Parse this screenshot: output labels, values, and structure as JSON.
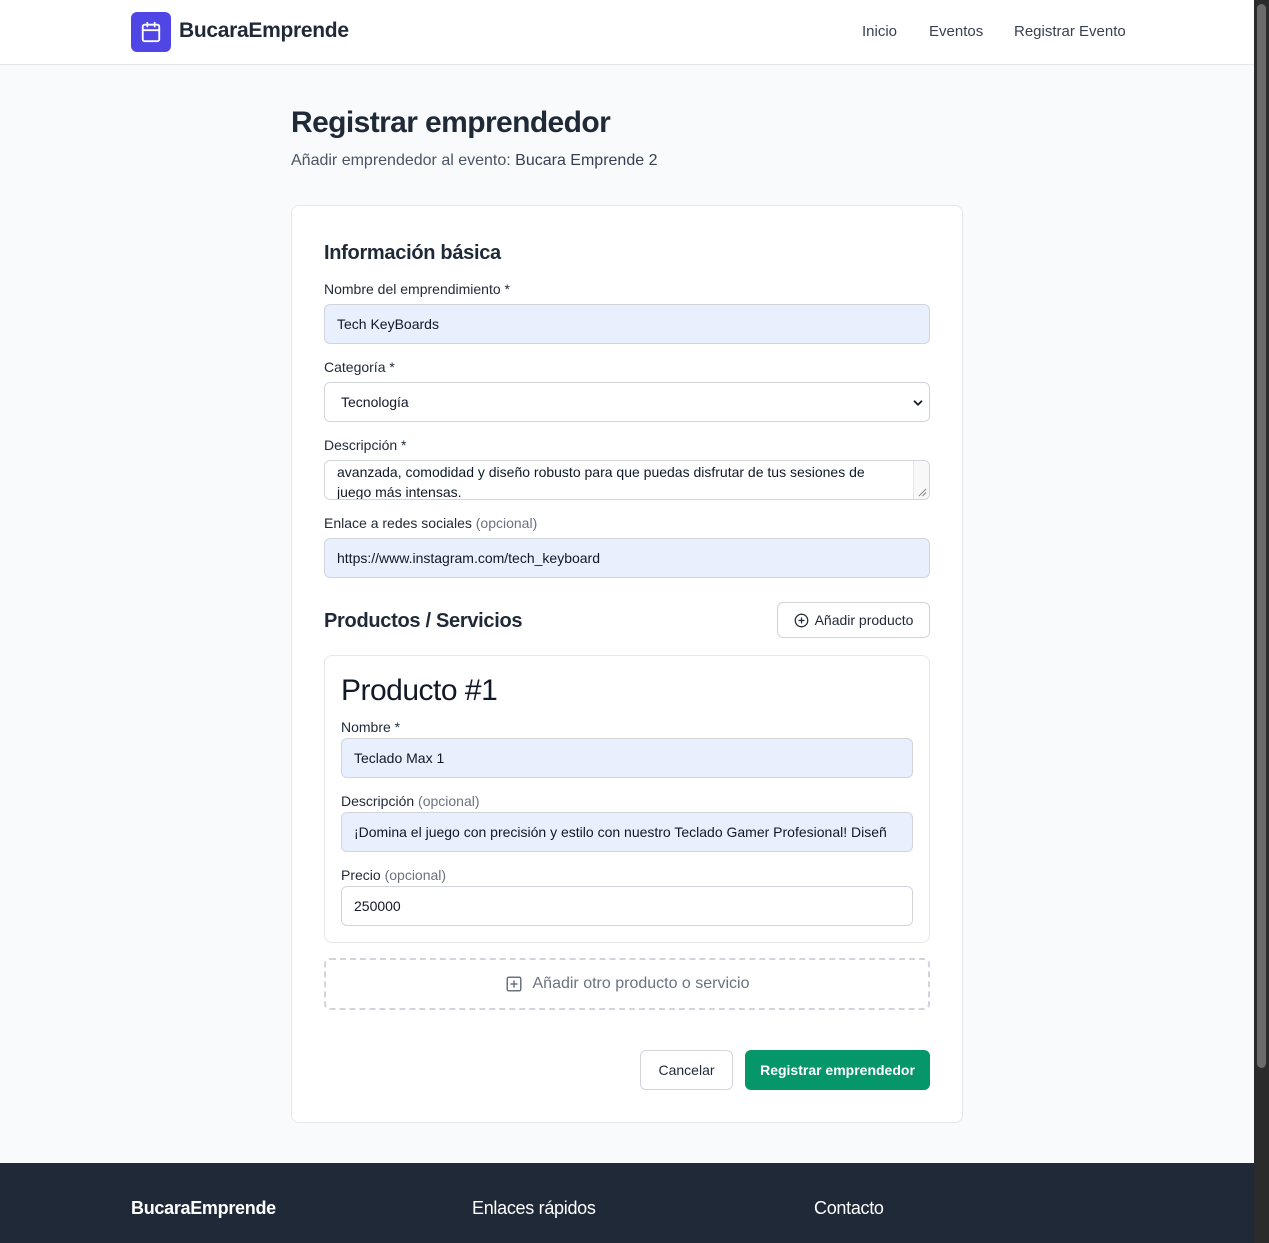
{
  "brand": {
    "name": "BucaraEmprende",
    "icon": "calendar-icon",
    "color": "#4f46e5"
  },
  "nav": {
    "items": [
      "Inicio",
      "Eventos",
      "Registrar Evento"
    ]
  },
  "page": {
    "title": "Registrar emprendedor",
    "subtitle_prefix": "Añadir emprendedor al evento:",
    "event_name": "Bucara Emprende 2"
  },
  "basic_info": {
    "section_title": "Información básica",
    "name_label": "Nombre del emprendimiento *",
    "name_value": "Tech KeyBoards",
    "category_label": "Categoría *",
    "category_value": "Tecnología",
    "description_label": "Descripción *",
    "description_value": "avanzada, comodidad y diseño robusto para que puedas disfrutar de tus sesiones de juego más intensas.",
    "social_label": "Enlace a redes sociales",
    "social_optional": "(opcional)",
    "social_value": "https://www.instagram.com/tech_keyboard"
  },
  "products": {
    "section_title": "Productos / Servicios",
    "add_button": "Añadir producto",
    "items": [
      {
        "title": "Producto #1",
        "name_label": "Nombre *",
        "name_value": "Teclado Max 1",
        "description_label": "Descripción",
        "description_optional": "(opcional)",
        "description_value": "¡Domina el juego con precisión y estilo con nuestro Teclado Gamer Profesional! Diseñ",
        "price_label": "Precio",
        "price_optional": "(opcional)",
        "price_value": "250000"
      }
    ],
    "add_another": "Añadir otro producto o servicio"
  },
  "actions": {
    "cancel": "Cancelar",
    "submit": "Registrar emprendedor",
    "submit_color": "#059669"
  },
  "footer": {
    "brand": "BucaraEmprende",
    "quick_links": "Enlaces rápidos",
    "contact": "Contacto"
  }
}
